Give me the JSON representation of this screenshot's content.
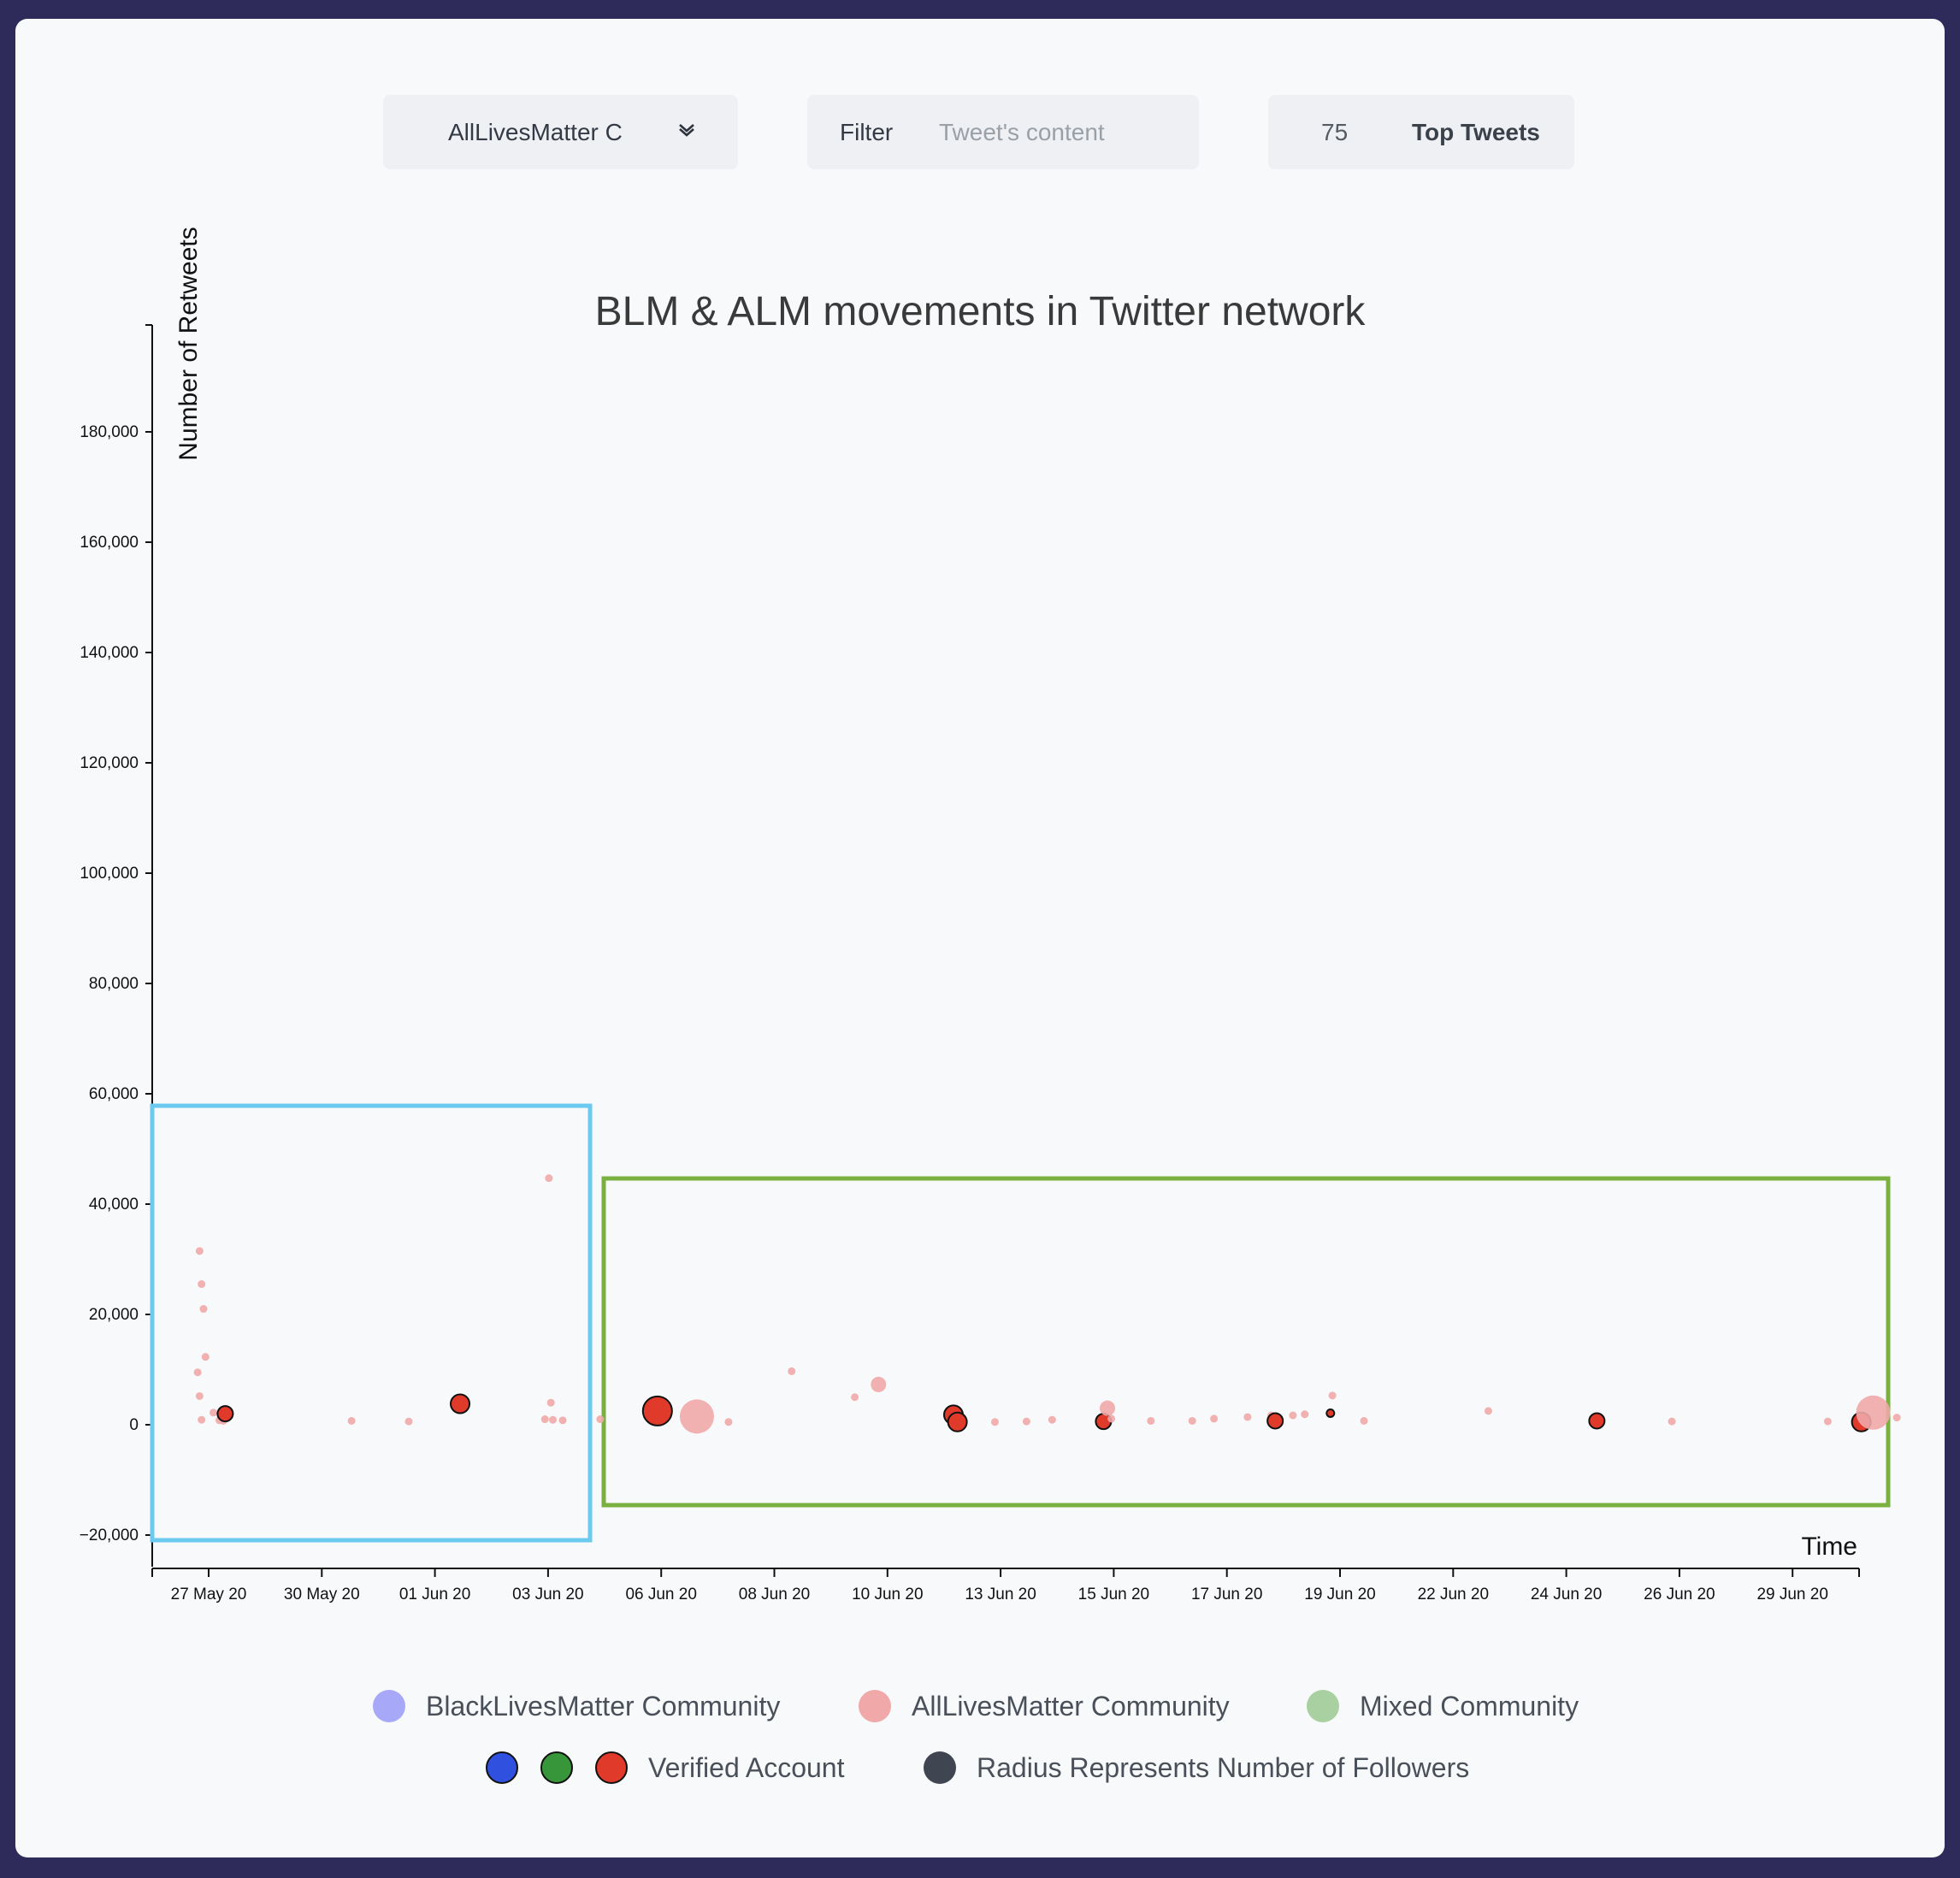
{
  "controls": {
    "community_select": "AllLivesMatter C",
    "filter_label": "Filter",
    "filter_placeholder": "Tweet's content",
    "top_count": "75",
    "top_label": "Top Tweets"
  },
  "colors": {
    "background": "#2e2a5a",
    "blm": "#a8a8f8",
    "alm": "#f0a8a8",
    "mixed": "#a8d0a0",
    "verified_blue": "#3050e0",
    "verified_green": "#38963a",
    "verified_red": "#e03a2a",
    "radius_dot": "#3f4652",
    "highlight_blue": "#6ccaf0",
    "highlight_green": "#7ab040"
  },
  "legend": {
    "blm": "BlackLivesMatter Community",
    "alm": "AllLivesMatter Community",
    "mixed": "Mixed Community",
    "verified": "Verified Account",
    "radius": "Radius Represents Number of Followers"
  },
  "chart_data": {
    "type": "scatter",
    "title": "BLM & ALM movements in Twitter network",
    "xlabel": "Time",
    "ylabel": "Number of Retweets",
    "x_ticks": [
      "27 May 20",
      "30 May 20",
      "01 Jun 20",
      "03 Jun 20",
      "06 Jun 20",
      "08 Jun 20",
      "10 Jun 20",
      "13 Jun 20",
      "15 Jun 20",
      "17 Jun 20",
      "19 Jun 20",
      "22 Jun 20",
      "24 Jun 20",
      "26 Jun 20",
      "29 Jun 20"
    ],
    "y_ticks": [
      -20000,
      0,
      20000,
      40000,
      60000,
      80000,
      100000,
      120000,
      140000,
      160000,
      180000
    ],
    "y_tick_labels": [
      "−20,000",
      "0",
      "20,000",
      "40,000",
      "60,000",
      "80,000",
      "100,000",
      "120,000",
      "140,000",
      "160,000",
      "180,000"
    ],
    "xlim": [
      "2020-05-25T12:00",
      "2020-06-30T12:00"
    ],
    "ylim": [
      -25000,
      200000
    ],
    "grid": false,
    "series": [
      {
        "name": "AllLivesMatter Community",
        "points": [
          {
            "x": "2020-05-26T12:00",
            "y": 31500,
            "size": "small",
            "verified": false
          },
          {
            "x": "2020-05-26T13:00",
            "y": 25500,
            "size": "small",
            "verified": false
          },
          {
            "x": "2020-05-26T14:00",
            "y": 21000,
            "size": "small",
            "verified": false
          },
          {
            "x": "2020-05-26T15:00",
            "y": 12300,
            "size": "small",
            "verified": false
          },
          {
            "x": "2020-05-26T11:00",
            "y": 9500,
            "size": "small",
            "verified": false
          },
          {
            "x": "2020-05-26T12:00",
            "y": 5200,
            "size": "small",
            "verified": false
          },
          {
            "x": "2020-05-26T19:00",
            "y": 2200,
            "size": "small",
            "verified": false
          },
          {
            "x": "2020-05-26T13:00",
            "y": 900,
            "size": "small",
            "verified": false
          },
          {
            "x": "2020-05-26T22:00",
            "y": 800,
            "size": "small",
            "verified": false
          },
          {
            "x": "2020-05-27T00:00",
            "y": 700,
            "size": "small",
            "verified": false
          },
          {
            "x": "2020-05-27T01:00",
            "y": 2000,
            "size": "medium",
            "verified": true
          },
          {
            "x": "2020-05-29T17:00",
            "y": 700,
            "size": "small",
            "verified": false
          },
          {
            "x": "2020-05-30T22:00",
            "y": 600,
            "size": "small",
            "verified": false
          },
          {
            "x": "2020-06-01T00:00",
            "y": 3800,
            "size": "large",
            "verified": true
          },
          {
            "x": "2020-06-02T21:00",
            "y": 44700,
            "size": "small",
            "verified": false
          },
          {
            "x": "2020-06-02T22:00",
            "y": 4000,
            "size": "small",
            "verified": false
          },
          {
            "x": "2020-06-02T19:00",
            "y": 1000,
            "size": "small",
            "verified": false
          },
          {
            "x": "2020-06-02T23:00",
            "y": 900,
            "size": "small",
            "verified": false
          },
          {
            "x": "2020-06-03T04:00",
            "y": 800,
            "size": "small",
            "verified": false
          },
          {
            "x": "2020-06-03T23:00",
            "y": 1000,
            "size": "small",
            "verified": false
          },
          {
            "x": "2020-06-05T04:00",
            "y": 2500,
            "size": "xlarge",
            "verified": true
          },
          {
            "x": "2020-06-06T00:00",
            "y": 1500,
            "size": "xxlarge",
            "verified": false
          },
          {
            "x": "2020-06-06T16:00",
            "y": 500,
            "size": "small",
            "verified": false
          },
          {
            "x": "2020-06-08T00:00",
            "y": 9700,
            "size": "small",
            "verified": false
          },
          {
            "x": "2020-06-09T08:00",
            "y": 5000,
            "size": "small",
            "verified": false
          },
          {
            "x": "2020-06-09T20:00",
            "y": 7300,
            "size": "medium",
            "verified": false
          },
          {
            "x": "2020-06-11T10:00",
            "y": 1800,
            "size": "large",
            "verified": true
          },
          {
            "x": "2020-06-11T12:00",
            "y": 500,
            "size": "large",
            "verified": true
          },
          {
            "x": "2020-06-12T07:00",
            "y": 500,
            "size": "small",
            "verified": false
          },
          {
            "x": "2020-06-12T23:00",
            "y": 600,
            "size": "small",
            "verified": false
          },
          {
            "x": "2020-06-13T12:00",
            "y": 900,
            "size": "small",
            "verified": false
          },
          {
            "x": "2020-06-14T14:00",
            "y": 600,
            "size": "medium",
            "verified": true
          },
          {
            "x": "2020-06-14T16:00",
            "y": 3000,
            "size": "medium",
            "verified": false
          },
          {
            "x": "2020-06-14T18:00",
            "y": 1100,
            "size": "small",
            "verified": false
          },
          {
            "x": "2020-06-15T14:00",
            "y": 700,
            "size": "small",
            "verified": false
          },
          {
            "x": "2020-06-16T11:00",
            "y": 700,
            "size": "small",
            "verified": false
          },
          {
            "x": "2020-06-16T22:00",
            "y": 1100,
            "size": "small",
            "verified": false
          },
          {
            "x": "2020-06-17T15:00",
            "y": 1400,
            "size": "small",
            "verified": false
          },
          {
            "x": "2020-06-18T03:00",
            "y": 1700,
            "size": "small",
            "verified": false
          },
          {
            "x": "2020-06-18T05:00",
            "y": 700,
            "size": "medium",
            "verified": true
          },
          {
            "x": "2020-06-18T14:00",
            "y": 1700,
            "size": "small",
            "verified": false
          },
          {
            "x": "2020-06-18T20:00",
            "y": 1900,
            "size": "small",
            "verified": false
          },
          {
            "x": "2020-06-19T10:00",
            "y": 5300,
            "size": "small",
            "verified": false
          },
          {
            "x": "2020-06-19T09:00",
            "y": 2100,
            "size": "small",
            "verified": true
          },
          {
            "x": "2020-06-20T02:00",
            "y": 700,
            "size": "small",
            "verified": false
          },
          {
            "x": "2020-06-22T17:00",
            "y": 2500,
            "size": "small",
            "verified": false
          },
          {
            "x": "2020-06-25T00:00",
            "y": 700,
            "size": "medium",
            "verified": true
          },
          {
            "x": "2020-06-26T14:00",
            "y": 600,
            "size": "small",
            "verified": false
          },
          {
            "x": "2020-06-29T21:00",
            "y": 600,
            "size": "small",
            "verified": false
          },
          {
            "x": "2020-06-30T14:00",
            "y": 500,
            "size": "large",
            "verified": true
          },
          {
            "x": "2020-06-30T20:00",
            "y": 2200,
            "size": "xxlarge",
            "verified": false
          },
          {
            "x": "2020-07-01T08:00",
            "y": 1300,
            "size": "small",
            "verified": false
          }
        ]
      }
    ]
  }
}
